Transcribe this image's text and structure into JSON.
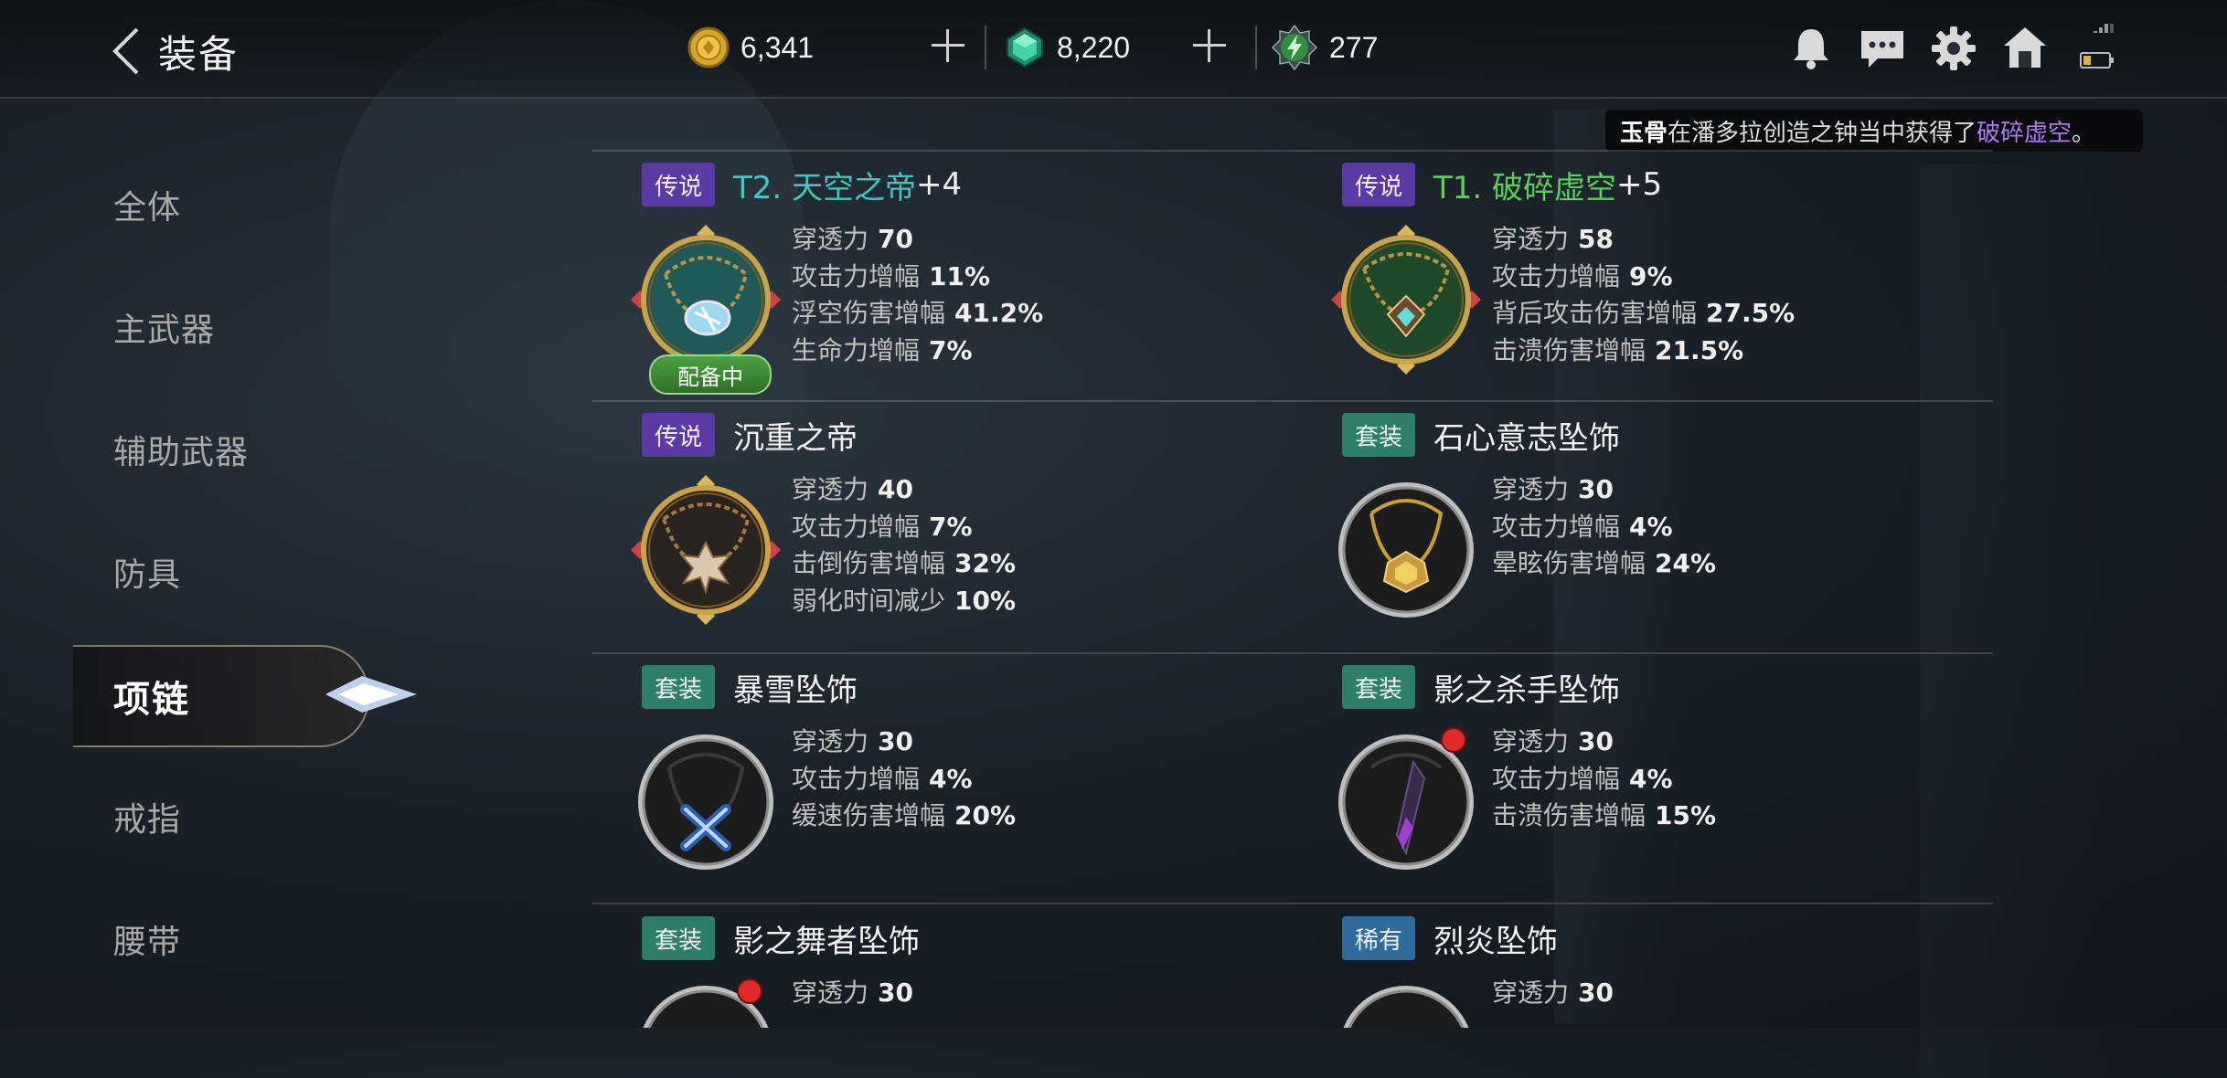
{
  "header": {
    "title": "装备",
    "gold": "6,341",
    "diamond": "8,220",
    "energy": "277"
  },
  "notice": {
    "player": "玉骨",
    "middle": "在潘多拉创造之钟当中获得了",
    "item": "破碎虚空",
    "end": "。"
  },
  "sidebar": {
    "items": [
      {
        "label": "全体"
      },
      {
        "label": "主武器"
      },
      {
        "label": "辅助武器"
      },
      {
        "label": "防具"
      },
      {
        "label": "项链"
      },
      {
        "label": "戒指"
      },
      {
        "label": "腰带"
      }
    ]
  },
  "items": [
    {
      "badge": "传说",
      "tier": "T2. 天空之帝",
      "name": "",
      "level": "+4",
      "equipped": "配备中",
      "stats": [
        {
          "k": "穿透力",
          "v": "70"
        },
        {
          "k": "攻击力增幅",
          "v": "11%"
        },
        {
          "k": "浮空伤害增幅",
          "v": "41.2%"
        },
        {
          "k": "生命力增幅",
          "v": "7%"
        }
      ]
    },
    {
      "badge": "传说",
      "tier": "T1. 破碎虚空",
      "name": "",
      "level": "+5",
      "stats": [
        {
          "k": "穿透力",
          "v": "58"
        },
        {
          "k": "攻击力增幅",
          "v": "9%"
        },
        {
          "k": "背后攻击伤害增幅",
          "v": "27.5%"
        },
        {
          "k": "击溃伤害增幅",
          "v": "21.5%"
        }
      ]
    },
    {
      "badge": "传说",
      "name": "沉重之帝",
      "stats": [
        {
          "k": "穿透力",
          "v": "40"
        },
        {
          "k": "攻击力增幅",
          "v": "7%"
        },
        {
          "k": "击倒伤害增幅",
          "v": "32%"
        },
        {
          "k": "弱化时间减少",
          "v": "10%"
        }
      ]
    },
    {
      "badge": "套装",
      "name": "石心意志坠饰",
      "stats": [
        {
          "k": "穿透力",
          "v": "30"
        },
        {
          "k": "攻击力增幅",
          "v": "4%"
        },
        {
          "k": "晕眩伤害增幅",
          "v": "24%"
        }
      ]
    },
    {
      "badge": "套装",
      "name": "暴雪坠饰",
      "stats": [
        {
          "k": "穿透力",
          "v": "30"
        },
        {
          "k": "攻击力增幅",
          "v": "4%"
        },
        {
          "k": "缓速伤害增幅",
          "v": "20%"
        }
      ]
    },
    {
      "badge": "套装",
      "name": "影之杀手坠饰",
      "stats": [
        {
          "k": "穿透力",
          "v": "30"
        },
        {
          "k": "攻击力增幅",
          "v": "4%"
        },
        {
          "k": "击溃伤害增幅",
          "v": "15%"
        }
      ]
    },
    {
      "badge": "套装",
      "name": "影之舞者坠饰",
      "stats": [
        {
          "k": "穿透力",
          "v": "30"
        }
      ]
    },
    {
      "badge": "稀有",
      "name": "烈炎坠饰",
      "stats": [
        {
          "k": "穿透力",
          "v": "30"
        }
      ]
    }
  ]
}
